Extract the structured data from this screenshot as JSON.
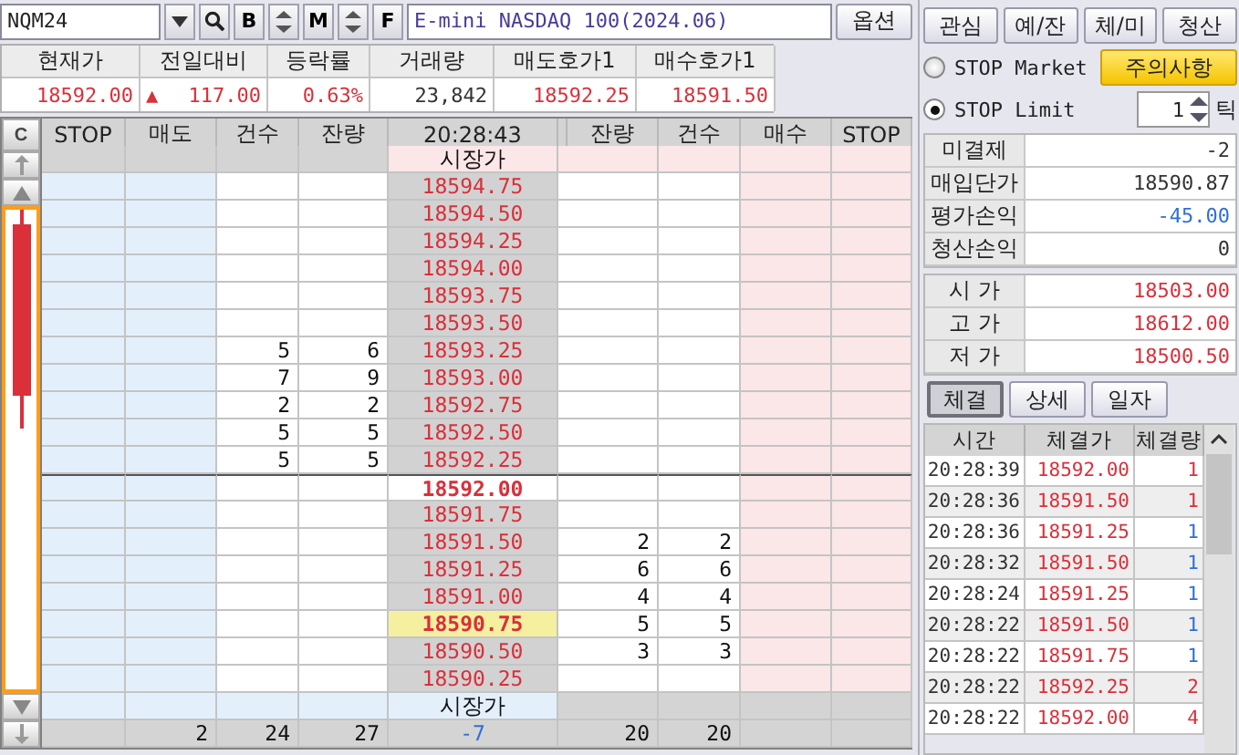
{
  "toolbar": {
    "symbol": "NQM24",
    "tools": [
      "B",
      "M",
      "F"
    ],
    "product_name": "E-mini NASDAQ 100(2024.06)",
    "option_button": "옵션"
  },
  "quote": [
    {
      "label": "현재가",
      "value": "18592.00",
      "color": "#d9303a"
    },
    {
      "label": "전일대비",
      "value": "117.00",
      "arrow": "▲",
      "color": "#d9303a"
    },
    {
      "label": "등락률",
      "value": "0.63%",
      "color": "#d9303a"
    },
    {
      "label": "거래량",
      "value": "23,842",
      "color": "#333333"
    },
    {
      "label": "매도호가1",
      "value": "18592.25",
      "color": "#d9303a"
    },
    {
      "label": "매수호가1",
      "value": "18591.50",
      "color": "#d9303a"
    }
  ],
  "orderbook": {
    "corner": "C",
    "columns": [
      "STOP",
      "매도",
      "건수",
      "잔량",
      "20:28:43",
      "잔량",
      "건수",
      "매수",
      "STOP"
    ],
    "rows": [
      {
        "kind": "market",
        "ask": true,
        "price": "시장가"
      },
      {
        "kind": "price",
        "price": "18594.75",
        "current": false,
        "entry": false
      },
      {
        "kind": "price",
        "price": "18594.50",
        "current": false,
        "entry": false
      },
      {
        "kind": "price",
        "price": "18594.25",
        "current": false,
        "entry": false
      },
      {
        "kind": "price",
        "price": "18594.00",
        "current": false,
        "entry": false
      },
      {
        "kind": "price",
        "price": "18593.75",
        "current": false,
        "entry": false
      },
      {
        "kind": "price",
        "price": "18593.50",
        "current": false,
        "entry": false
      },
      {
        "kind": "price",
        "price": "18593.25",
        "ask_count": "5",
        "ask_qty": "6",
        "current": false,
        "entry": false
      },
      {
        "kind": "price",
        "price": "18593.00",
        "ask_count": "7",
        "ask_qty": "9",
        "current": false,
        "entry": false
      },
      {
        "kind": "price",
        "price": "18592.75",
        "ask_count": "2",
        "ask_qty": "2",
        "current": false,
        "entry": false
      },
      {
        "kind": "price",
        "price": "18592.50",
        "ask_count": "5",
        "ask_qty": "5",
        "current": false,
        "entry": false
      },
      {
        "kind": "price",
        "price": "18592.25",
        "ask_count": "5",
        "ask_qty": "5",
        "current": false,
        "entry": false
      },
      {
        "kind": "price",
        "price": "18592.00",
        "current": true,
        "entry": false
      },
      {
        "kind": "price",
        "price": "18591.75",
        "current": false,
        "entry": false
      },
      {
        "kind": "price",
        "price": "18591.50",
        "bid_qty": "2",
        "bid_count": "2",
        "current": false,
        "entry": false
      },
      {
        "kind": "price",
        "price": "18591.25",
        "bid_qty": "6",
        "bid_count": "6",
        "current": false,
        "entry": false
      },
      {
        "kind": "price",
        "price": "18591.00",
        "bid_qty": "4",
        "bid_count": "4",
        "current": false,
        "entry": false
      },
      {
        "kind": "price",
        "price": "18590.75",
        "bid_qty": "5",
        "bid_count": "5",
        "current": false,
        "entry": true
      },
      {
        "kind": "price",
        "price": "18590.50",
        "bid_qty": "3",
        "bid_count": "3",
        "current": false,
        "entry": false
      },
      {
        "kind": "price",
        "price": "18590.25",
        "current": false,
        "entry": false
      },
      {
        "kind": "market",
        "ask": false,
        "price": "시장가"
      }
    ],
    "totals": {
      "sell_order": "2",
      "sell_count": "24",
      "sell_qty": "27",
      "net": "-7",
      "buy_qty": "20",
      "buy_count": "20"
    }
  },
  "right": {
    "tabs": [
      "관심",
      "예/잔",
      "체/미",
      "청산"
    ],
    "stop_types": [
      {
        "label": "STOP Market",
        "selected": false
      },
      {
        "label": "STOP Limit",
        "selected": true
      }
    ],
    "notice_button": "주의사항",
    "tick_value": "1",
    "tick_unit": "틱",
    "account": [
      {
        "label": "미결제",
        "value": "-2",
        "color": "#333333"
      },
      {
        "label": "매입단가",
        "value": "18590.87",
        "color": "#333333"
      },
      {
        "label": "평가손익",
        "value": "-45.00",
        "color": "#2f6fd6"
      },
      {
        "label": "청산손익",
        "value": "0",
        "color": "#333333"
      }
    ],
    "prices": [
      {
        "label": "시 가",
        "value": "18503.00"
      },
      {
        "label": "고 가",
        "value": "18612.00"
      },
      {
        "label": "저 가",
        "value": "18500.50"
      }
    ],
    "sub_tabs": [
      {
        "label": "체결",
        "selected": true
      },
      {
        "label": "상세",
        "selected": false
      },
      {
        "label": "일자",
        "selected": false
      }
    ],
    "trade_columns": [
      "시간",
      "체결가",
      "체결량"
    ],
    "trades": [
      {
        "time": "20:28:39",
        "price": "18592.00",
        "qty": "1",
        "color": "#d9303a"
      },
      {
        "time": "20:28:36",
        "price": "18591.50",
        "qty": "1",
        "color": "#d9303a"
      },
      {
        "time": "20:28:36",
        "price": "18591.25",
        "qty": "1",
        "color": "#2f6fd6"
      },
      {
        "time": "20:28:32",
        "price": "18591.50",
        "qty": "1",
        "color": "#2f6fd6"
      },
      {
        "time": "20:28:24",
        "price": "18591.25",
        "qty": "1",
        "color": "#2f6fd6"
      },
      {
        "time": "20:28:22",
        "price": "18591.50",
        "qty": "1",
        "color": "#2f6fd6"
      },
      {
        "time": "20:28:22",
        "price": "18591.75",
        "qty": "1",
        "color": "#2f6fd6"
      },
      {
        "time": "20:28:22",
        "price": "18592.25",
        "qty": "2",
        "color": "#d9303a"
      },
      {
        "time": "20:28:22",
        "price": "18592.00",
        "qty": "4",
        "color": "#d9303a"
      }
    ]
  }
}
